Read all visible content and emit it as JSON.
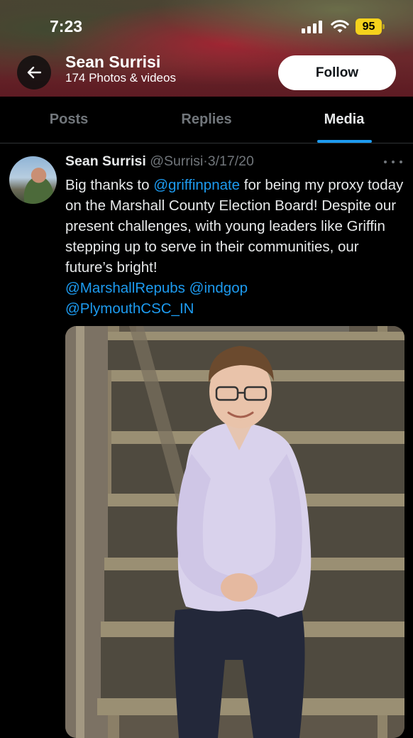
{
  "status_bar": {
    "time": "7:23",
    "battery": "95"
  },
  "profile_header": {
    "name": "Sean Surrisi",
    "subtitle": "174 Photos & videos",
    "follow_label": "Follow"
  },
  "tabs": [
    {
      "label": "Posts",
      "active": false
    },
    {
      "label": "Replies",
      "active": false
    },
    {
      "label": "Media",
      "active": true
    }
  ],
  "post": {
    "author": "Sean Surrisi",
    "handle": "@Surrisi",
    "separator": "·",
    "date": "3/17/20",
    "text_1": "Big thanks to ",
    "mention_1": "@griffinpnate",
    "text_2": " for being my proxy today on the Marshall County Election Board! Despite our present challenges, with young leaders like Griffin stepping up to serve in their communities, our future’s bright!",
    "mention_2": "@MarshallRepubs",
    "mention_3": "@indgop",
    "mention_4": "@PlymouthCSC_IN"
  },
  "colors": {
    "background": "#000000",
    "text_primary": "#e7e9ea",
    "text_secondary": "#71767b",
    "accent": "#1d9bf0",
    "battery": "#f5d21c"
  },
  "icons": [
    "back-arrow-icon",
    "signal-icon",
    "wifi-icon",
    "battery-icon",
    "more-options-icon"
  ]
}
